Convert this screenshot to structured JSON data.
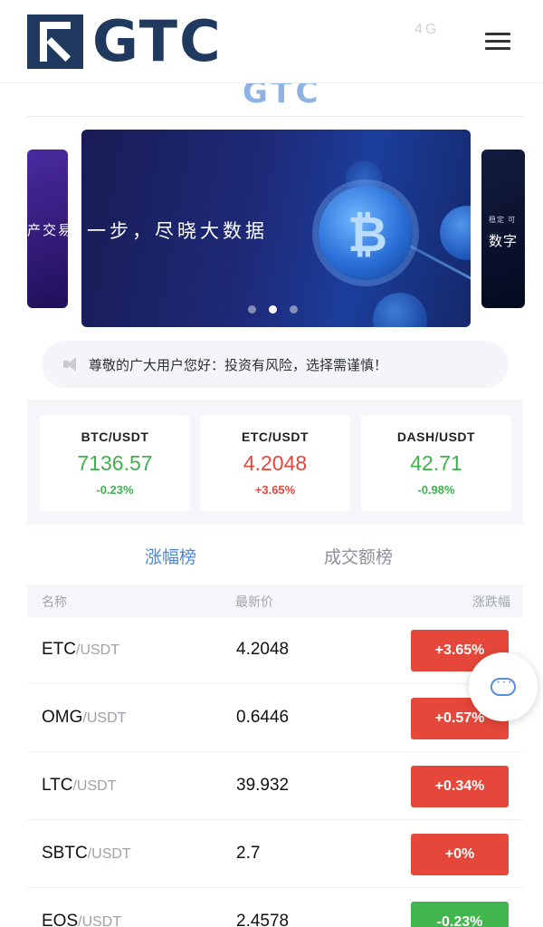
{
  "header": {
    "logo_text": "GTC",
    "status_faint": "4G",
    "menu_icon": "hamburger-menu-icon"
  },
  "faded_title": "GTC",
  "banner": {
    "left_peek_text": "产交易",
    "main_text": "一步，尽晓大数据",
    "right_peek_small": "稳定 可",
    "right_peek_text": "数字",
    "slides_count": 3,
    "active_slide": 2
  },
  "notice": {
    "icon": "speaker-icon",
    "text": "尊敬的广大用户您好：投资有风险，选择需谨慎！"
  },
  "tickers": [
    {
      "pair": "BTC/USDT",
      "price": "7136.57",
      "change": "-0.23%",
      "trend": "down"
    },
    {
      "pair": "ETC/USDT",
      "price": "4.2048",
      "change": "+3.65%",
      "trend": "up"
    },
    {
      "pair": "DASH/USDT",
      "price": "42.71",
      "change": "-0.98%",
      "trend": "down"
    }
  ],
  "tabs": {
    "gainers": "涨幅榜",
    "volume": "成交额榜"
  },
  "list_header": {
    "name": "名称",
    "price": "最新价",
    "change": "涨跌幅"
  },
  "rows": [
    {
      "base": "ETC",
      "quote": "/USDT",
      "price": "4.2048",
      "change": "+3.65%",
      "trend": "up"
    },
    {
      "base": "OMG",
      "quote": "/USDT",
      "price": "0.6446",
      "change": "+0.57%",
      "trend": "up"
    },
    {
      "base": "LTC",
      "quote": "/USDT",
      "price": "39.932",
      "change": "+0.34%",
      "trend": "up"
    },
    {
      "base": "SBTC",
      "quote": "/USDT",
      "price": "2.7",
      "change": "+0%",
      "trend": "up"
    },
    {
      "base": "EOS",
      "quote": "/USDT",
      "price": "2.4578",
      "change": "-0.23%",
      "trend": "down"
    }
  ],
  "chat_icon": "customer-service-icon",
  "colors": {
    "brand": "#1f3a5e",
    "accent": "#4a86de",
    "up": "#e5473a",
    "down": "#3eb24a"
  }
}
